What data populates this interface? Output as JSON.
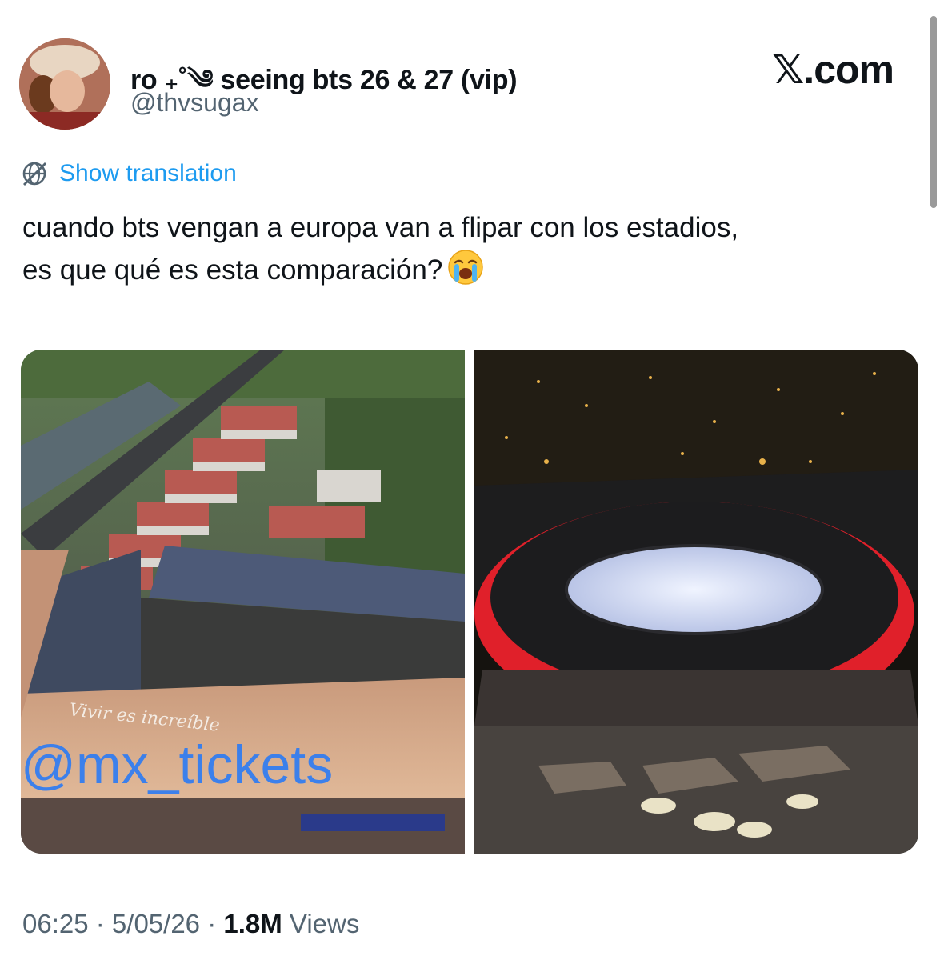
{
  "author": {
    "display_name": "ro ₊˚༄ seeing bts 26 & 27 (vip)",
    "handle": "@thvsugax"
  },
  "brand": {
    "label": "𝕏.com"
  },
  "translation": {
    "label": "Show translation",
    "icon": "globe-slash-icon"
  },
  "tweet": {
    "line1": "cuando bts vengan a europa van a flipar con los estadios,",
    "line2": "es que qué es esta comparación?",
    "emoji": "loudly-crying-face"
  },
  "media": {
    "left_watermark": "@mx_tickets",
    "left_roof_text": "Vivir es increíble"
  },
  "meta": {
    "time": "06:25",
    "separator": " · ",
    "date": "5/05/26",
    "views_count": "1.8M",
    "views_label": "Views"
  },
  "colors": {
    "link": "#1d9bf0",
    "secondary": "#536471",
    "stadium_red": "#e0202a"
  }
}
